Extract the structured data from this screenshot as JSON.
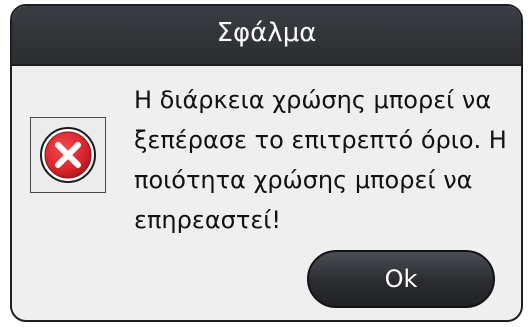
{
  "dialog": {
    "title": "Σφάλμα",
    "icon": "error-icon",
    "message_lines": [
      "Η διάρκεια χρώσης μπορεί να",
      "ξεπέρασε το επιτρεπτό όριο. Η",
      "ποιότητα χρώσης μπορεί να",
      "επηρεαστεί!"
    ],
    "ok_label": "Ok"
  },
  "colors": {
    "titlebar": "#2b2d31",
    "body": "#f0efef",
    "error_red": "#d8242b",
    "button": "#2a2c30"
  }
}
